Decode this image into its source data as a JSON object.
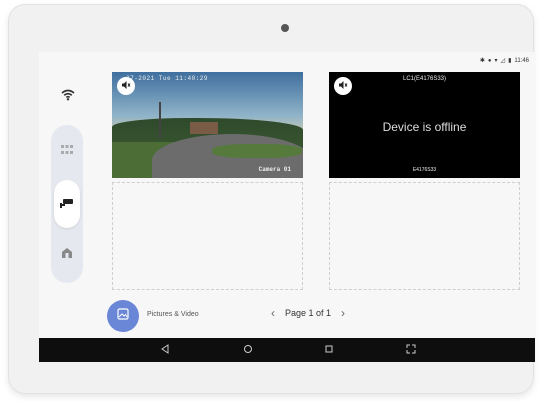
{
  "status_bar": {
    "time": "11:46"
  },
  "cameras": [
    {
      "timestamp": "27-2021 Tue 11:40:29",
      "name": "Camera 01"
    },
    {
      "id_top": "LC1(E4176S33)",
      "status": "Device is offline",
      "id_bottom": "E4176S33"
    }
  ],
  "bottom": {
    "pictures_label": "Pictures & Video",
    "page_label": "Page 1 of 1"
  },
  "colors": {
    "accent": "#6a86d6",
    "side_pill": "#e6e8ef",
    "nav_bar": "#0e0e0e"
  },
  "icons": {
    "wifi": "wifi-icon",
    "grid": "grid-icon",
    "camera": "cctv-camera-icon",
    "home": "home-icon",
    "mute": "speaker-mute-icon",
    "gallery": "image-gallery-icon"
  }
}
